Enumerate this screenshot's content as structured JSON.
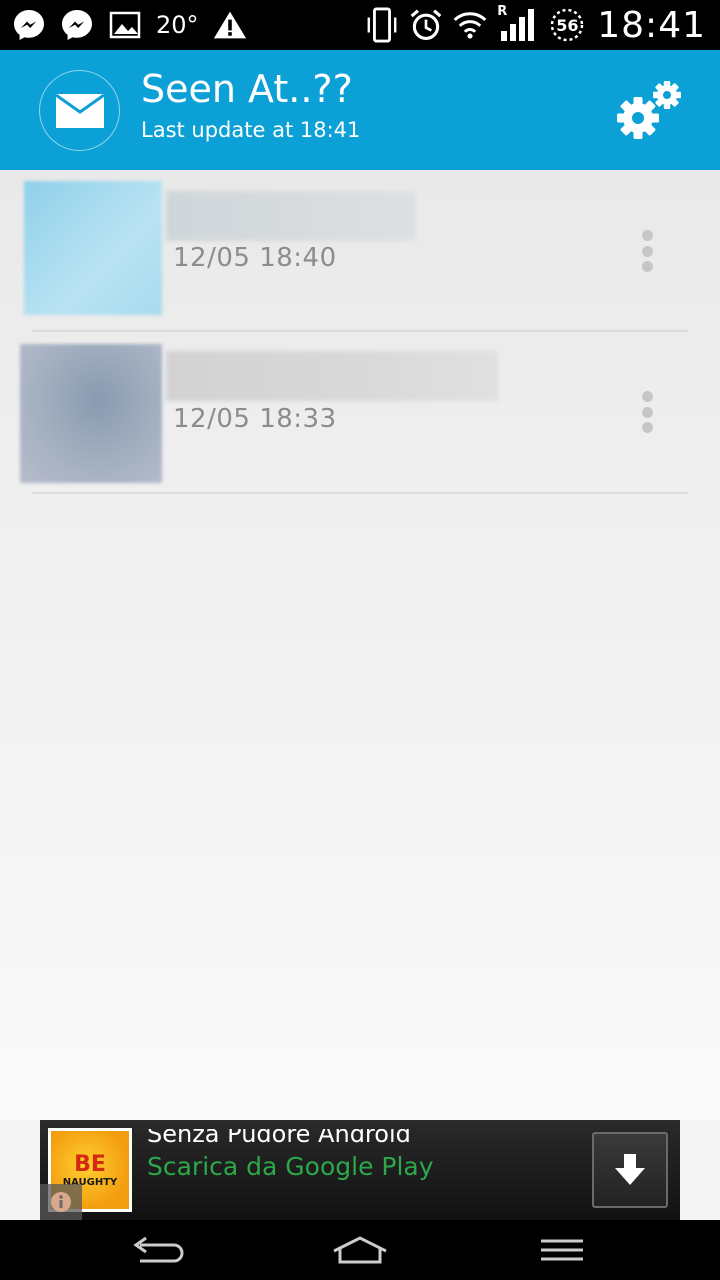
{
  "status_bar": {
    "left_icons": [
      "messenger-icon",
      "messenger-icon",
      "gallery-icon",
      "warning-icon"
    ],
    "temperature": "20°",
    "right_icons": [
      "vibrate-icon",
      "alarm-icon",
      "wifi-icon",
      "signal-icon",
      "battery-icon"
    ],
    "roaming_label": "R",
    "battery_level": "56",
    "time": "18:41"
  },
  "header": {
    "title": "Seen At..??",
    "subtitle": "Last update at 18:41",
    "logo_icon": "envelope-icon",
    "settings_icon": "gears-icon",
    "color": "#0ba0d6"
  },
  "list": {
    "items": [
      {
        "timestamp": "12/05 18:40",
        "menu_icon": "overflow-menu-icon"
      },
      {
        "timestamp": "12/05 18:33",
        "menu_icon": "overflow-menu-icon"
      }
    ]
  },
  "ad": {
    "title": "Senza Pudore Android",
    "subtitle": "Scarica da Google Play",
    "logo_line1": "BE",
    "logo_line2": "NAUGHTY",
    "info_icon": "info-icon",
    "download_icon": "download-arrow-icon",
    "subtitle_color": "#2ca84a"
  },
  "nav_bar": {
    "icons": [
      "back-icon",
      "home-icon",
      "menu-icon"
    ]
  }
}
